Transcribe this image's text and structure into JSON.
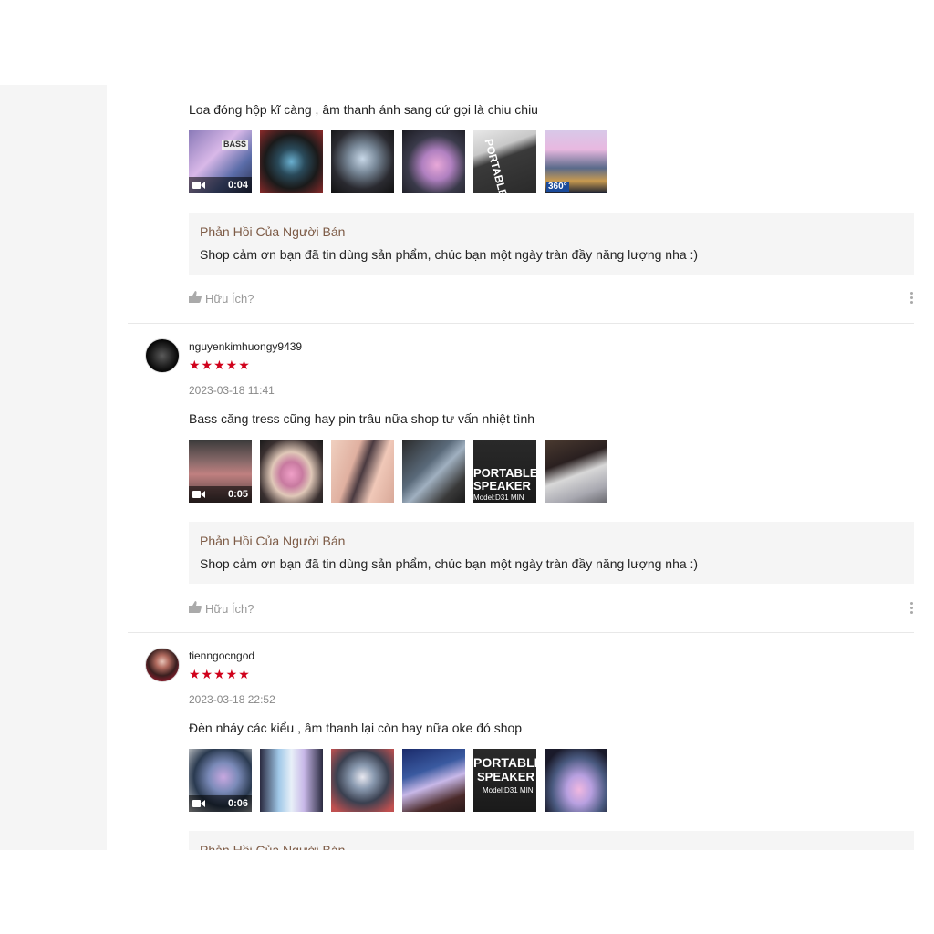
{
  "reviews": [
    {
      "comment": "Loa đóng hộp kĩ càng , âm thanh ánh sang cứ gọi là chiu chiu",
      "video_duration": "0:04",
      "thumb_texts": [
        "BASS",
        "PORTABLE SPEAKER",
        "360°"
      ],
      "seller_reply": {
        "title": "Phản Hồi Của Người Bán",
        "text": "Shop cảm ơn bạn đã tin dùng sản phẩm, chúc bạn một ngày tràn đầy năng lượng nha :)"
      },
      "helpful_label": "Hữu Ích?"
    },
    {
      "username": "nguyenkimhuongy9439",
      "stars": "★★★★★",
      "timestamp": "2023-03-18 11:41",
      "comment": "Bass căng tress cũng hay pin trâu nữa shop tư vấn nhiệt tình",
      "video_duration": "0:05",
      "thumb_texts": [
        "PORTABLE",
        "SPEAKER",
        "Model:D31 MIN"
      ],
      "seller_reply": {
        "title": "Phản Hồi Của Người Bán",
        "text": "Shop cảm ơn bạn đã tin dùng sản phẩm, chúc bạn một ngày tràn đầy năng lượng nha :)"
      },
      "helpful_label": "Hữu Ích?"
    },
    {
      "username": "tienngocngod",
      "stars": "★★★★★",
      "timestamp": "2023-03-18 22:52",
      "comment": "Đèn nháy các kiểu , âm thanh lại còn hay nữa oke đó shop",
      "video_duration": "0:06",
      "thumb_texts": [
        "PORTABLE",
        "SPEAKER",
        "Model:D31 MIN"
      ],
      "seller_reply": {
        "title": "Phản Hồi Của Người Bán"
      }
    }
  ],
  "colors": {
    "star": "#d0011b",
    "reply_title": "#7d5b46",
    "reply_bg": "#f5f5f5",
    "muted": "#999999"
  },
  "icons": {
    "video": "video-camera-icon",
    "thumb": "thumbs-up-icon",
    "more": "more-vertical-icon"
  }
}
